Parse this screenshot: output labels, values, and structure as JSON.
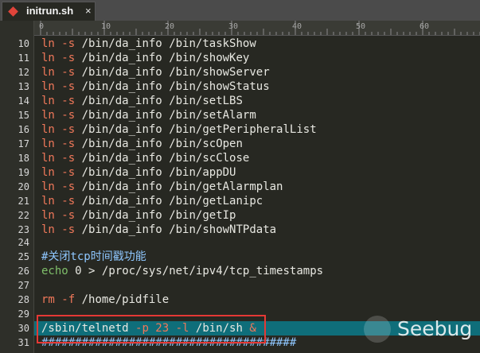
{
  "tab": {
    "filename": "initrun.sh",
    "close": "×",
    "icon": "file-diamond-icon"
  },
  "ruler": [
    "0",
    "10",
    "20",
    "30",
    "40",
    "50",
    "60"
  ],
  "lines": [
    {
      "n": "10",
      "cmd": "ln",
      "flag": "-s",
      "path": "/bin/da_info",
      "target": "/bin/",
      "name": "taskShow"
    },
    {
      "n": "11",
      "cmd": "ln",
      "flag": "-s",
      "path": "/bin/da_info",
      "target": "/bin/",
      "name": "showKey"
    },
    {
      "n": "12",
      "cmd": "ln",
      "flag": "-s",
      "path": "/bin/da_info",
      "target": "/bin/",
      "name": "showServer"
    },
    {
      "n": "13",
      "cmd": "ln",
      "flag": "-s",
      "path": "/bin/da_info",
      "target": "/bin/",
      "name": "showStatus"
    },
    {
      "n": "14",
      "cmd": "ln",
      "flag": "-s",
      "path": "/bin/da_info",
      "target": "/bin/",
      "name": "setLBS"
    },
    {
      "n": "15",
      "cmd": "ln",
      "flag": "-s",
      "path": "/bin/da_info",
      "target": "/bin/",
      "name": "setAlarm"
    },
    {
      "n": "16",
      "cmd": "ln",
      "flag": "-s",
      "path": "/bin/da_info",
      "target": "/bin/",
      "name": "getPeripheralList"
    },
    {
      "n": "17",
      "cmd": "ln",
      "flag": "-s",
      "path": "/bin/da_info",
      "target": "/bin/",
      "name": "scOpen"
    },
    {
      "n": "18",
      "cmd": "ln",
      "flag": "-s",
      "path": "/bin/da_info",
      "target": "/bin/",
      "name": "scClose"
    },
    {
      "n": "19",
      "cmd": "ln",
      "flag": "-s",
      "path": "/bin/da_info",
      "target": "/bin/",
      "name": "appDU"
    },
    {
      "n": "20",
      "cmd": "ln",
      "flag": "-s",
      "path": "/bin/da_info",
      "target": "/bin/",
      "name": "getAlarmplan"
    },
    {
      "n": "21",
      "cmd": "ln",
      "flag": "-s",
      "path": "/bin/da_info",
      "target": "/bin/",
      "name": "getLanipc"
    },
    {
      "n": "22",
      "cmd": "ln",
      "flag": "-s",
      "path": "/bin/da_info",
      "target": "/bin/",
      "name": "getIp"
    },
    {
      "n": "23",
      "cmd": "ln",
      "flag": "-s",
      "path": "/bin/da_info",
      "target": "/bin/",
      "name": "showNTPdata"
    }
  ],
  "line24": {
    "n": "24"
  },
  "line25": {
    "n": "25",
    "comment": "#关闭tcp时间戳功能"
  },
  "line26": {
    "n": "26",
    "kw": "echo",
    "val": "0",
    "op": ">",
    "path": "/proc/sys/net/ipv4/tcp_timestamps"
  },
  "line27": {
    "n": "27"
  },
  "line28": {
    "n": "28",
    "cmd": "rm",
    "flag": "-f",
    "path": "/home/pidfile"
  },
  "line29": {
    "n": "29"
  },
  "line30": {
    "n": "30",
    "bin": "/sbin/telnetd",
    "args": "-p 23 -l",
    "shell": "/bin/sh",
    "amp": "&"
  },
  "line31": {
    "n": "31",
    "hashes": "######################################"
  },
  "watermark": {
    "text": "Seebug",
    "icon": "seebug-logo-icon"
  }
}
